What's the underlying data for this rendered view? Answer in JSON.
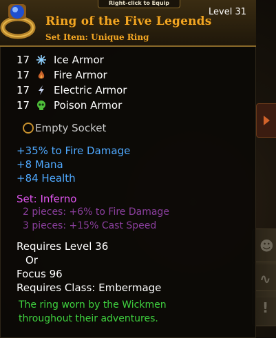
{
  "tooltip": {
    "hint": "Right-click to Equip",
    "level": "Level 31",
    "title": "Ring of the Five Legends",
    "subtitle": "Set Item: Unique Ring",
    "armors": [
      {
        "value": "17",
        "label": "Ice Armor",
        "icon": "snowflake-icon"
      },
      {
        "value": "17",
        "label": "Fire Armor",
        "icon": "flame-icon"
      },
      {
        "value": "17",
        "label": "Electric Armor",
        "icon": "lightning-icon"
      },
      {
        "value": "17",
        "label": "Poison Armor",
        "icon": "poison-skull-icon"
      }
    ],
    "socket": "Empty Socket",
    "stats": [
      "+35% to Fire Damage",
      "+8 Mana",
      "+84 Health"
    ],
    "set": {
      "name": "Set: Inferno",
      "bonuses": [
        "2 pieces: +6% to Fire Damage",
        "3 pieces: +15% Cast Speed"
      ]
    },
    "requirements": {
      "level": "Requires Level 36",
      "or": "Or",
      "focus": "Focus 96",
      "class": "Requires Class: Embermage"
    },
    "flavor": [
      "The ring worn by the Wickmen",
      "throughout their adventures."
    ]
  },
  "colors": {
    "title": "#f2a623",
    "stat": "#4fa9ff",
    "set": "#e055f0",
    "set_bonus": "#8b3f9e",
    "flavor": "#3fd33f"
  }
}
